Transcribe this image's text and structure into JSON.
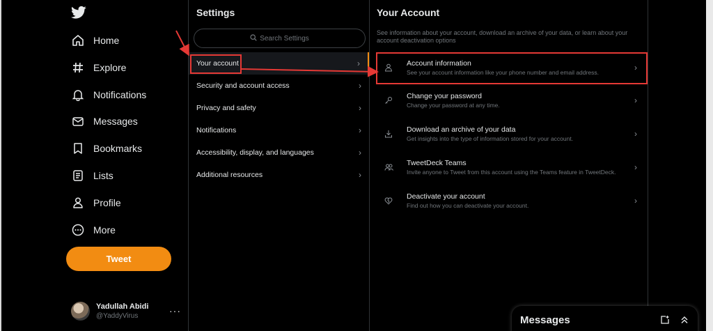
{
  "nav": {
    "logo": "twitter-bird-icon",
    "items": [
      {
        "label": "Home",
        "icon": "home-icon"
      },
      {
        "label": "Explore",
        "icon": "hashtag-icon"
      },
      {
        "label": "Notifications",
        "icon": "bell-icon"
      },
      {
        "label": "Messages",
        "icon": "envelope-icon"
      },
      {
        "label": "Bookmarks",
        "icon": "bookmark-icon"
      },
      {
        "label": "Lists",
        "icon": "list-icon"
      },
      {
        "label": "Profile",
        "icon": "person-icon"
      },
      {
        "label": "More",
        "icon": "more-circle-icon"
      }
    ],
    "tweet_label": "Tweet",
    "profile": {
      "name": "Yadullah Abidi",
      "handle": "@YaddyVirus",
      "more": "···"
    }
  },
  "settings": {
    "title": "Settings",
    "search_placeholder": "Search Settings",
    "items": [
      {
        "label": "Your account"
      },
      {
        "label": "Security and account access"
      },
      {
        "label": "Privacy and safety"
      },
      {
        "label": "Notifications"
      },
      {
        "label": "Accessibility, display, and languages"
      },
      {
        "label": "Additional resources"
      }
    ]
  },
  "account": {
    "title": "Your Account",
    "description": "See information about your account, download an archive of your data, or learn about your account deactivation options",
    "items": [
      {
        "title": "Account information",
        "subtitle": "See your account information like your phone number and email address.",
        "icon": "person-icon"
      },
      {
        "title": "Change your password",
        "subtitle": "Change your password at any time.",
        "icon": "key-icon"
      },
      {
        "title": "Download an archive of your data",
        "subtitle": "Get insights into the type of information stored for your account.",
        "icon": "download-icon"
      },
      {
        "title": "TweetDeck Teams",
        "subtitle": "Invite anyone to Tweet from this account using the Teams feature in TweetDeck.",
        "icon": "team-icon"
      },
      {
        "title": "Deactivate your account",
        "subtitle": "Find out how you can deactivate your account.",
        "icon": "broken-heart-icon"
      }
    ]
  },
  "messages_drawer": {
    "title": "Messages"
  },
  "colors": {
    "accent": "#f28c12",
    "annotation": "#e53935",
    "background": "#000000"
  }
}
